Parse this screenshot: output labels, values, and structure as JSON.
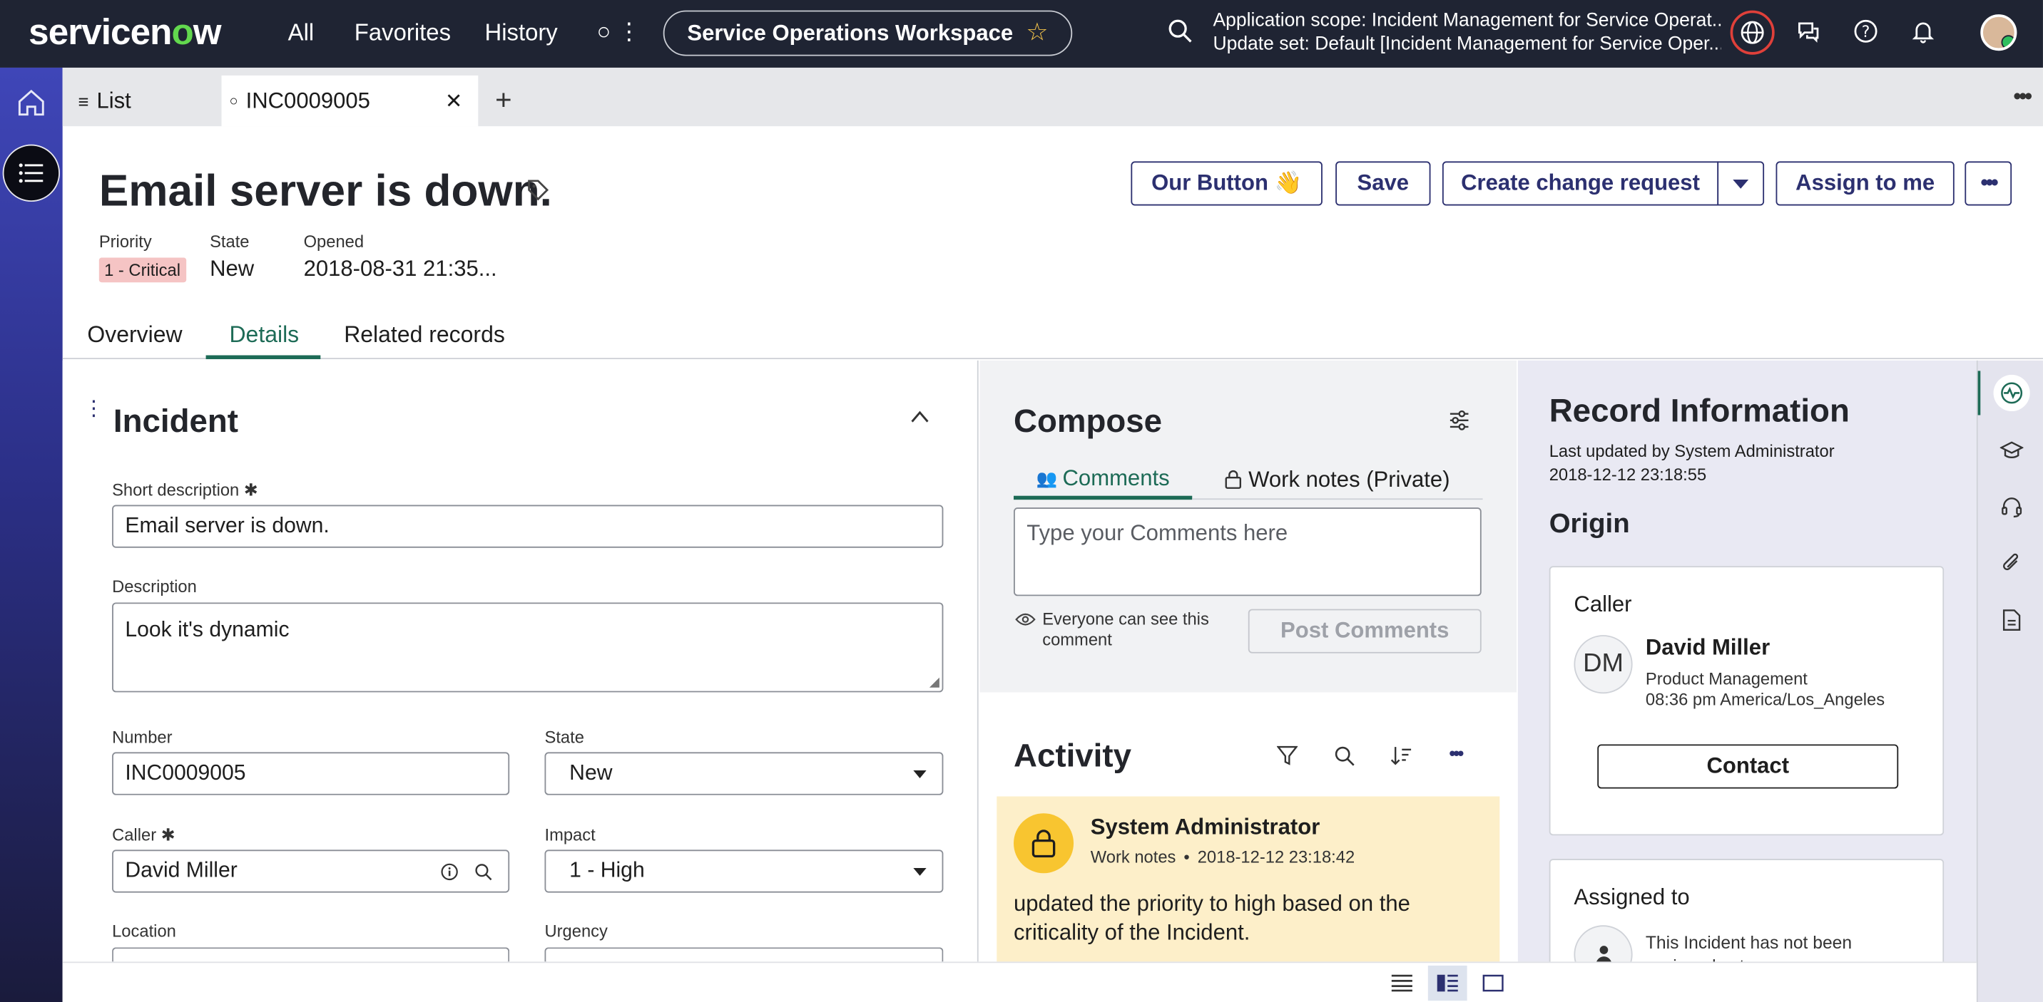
{
  "topnav": {
    "logo_pre": "servicen",
    "logo_o": "o",
    "logo_post": "w",
    "links": [
      "All",
      "Favorites",
      "History"
    ],
    "more_label": "○ ⋮",
    "workspace": "Service Operations Workspace",
    "scope_line1": "Application scope: Incident Management for Service Operat...",
    "scope_line2": "Update set: Default [Incident Management for Service Oper..."
  },
  "tabs": {
    "list_label": "List",
    "record_label": "INC0009005"
  },
  "header": {
    "title": "Email server is down.",
    "priority_label": "Priority",
    "priority_value": "1 - Critical",
    "state_label": "State",
    "state_value": "New",
    "opened_label": "Opened",
    "opened_value": "2018-08-31 21:35...",
    "buttons": {
      "our_button": "Our Button 👋",
      "save": "Save",
      "create_change": "Create change request",
      "assign": "Assign to me"
    }
  },
  "section_tabs": [
    "Overview",
    "Details",
    "Related records"
  ],
  "form": {
    "section_title": "Incident",
    "short_description_label": "Short description ✱",
    "short_description_value": "Email server is down.",
    "description_label": "Description",
    "description_value": "Look it's dynamic",
    "number_label": "Number",
    "number_value": "INC0009005",
    "state_label": "State",
    "state_value": "New",
    "caller_label": "Caller ✱",
    "caller_value": "David Miller",
    "impact_label": "Impact",
    "impact_value": "1 - High",
    "location_label": "Location",
    "urgency_label": "Urgency"
  },
  "compose": {
    "title": "Compose",
    "tab_comments": "Comments",
    "tab_worknotes": "Work notes (Private)",
    "placeholder": "Type your Comments here",
    "visibility_note_1": "Everyone can see this",
    "visibility_note_2": "comment",
    "post_button": "Post Comments"
  },
  "activity": {
    "title": "Activity",
    "entry_author": "System Administrator",
    "entry_type": "Work notes",
    "entry_time": "2018-12-12 23:18:42",
    "entry_text_1": "updated the priority to high based on the",
    "entry_text_2": "criticality of the Incident."
  },
  "record_info": {
    "title": "Record Information",
    "updated_by": "Last updated by System Administrator",
    "updated_at": "2018-12-12 23:18:55",
    "origin_title": "Origin",
    "caller_heading": "Caller",
    "caller_initials": "DM",
    "caller_name": "David Miller",
    "caller_dept": "Product Management",
    "caller_time": "08:36 pm America/Los_Angeles",
    "contact_button": "Contact",
    "assigned_heading": "Assigned to",
    "assigned_text_1": "This Incident has not been",
    "assigned_text_2": "assigned yet"
  },
  "colors": {
    "nav_bg": "#1f2433",
    "accent_green": "#1d6b56",
    "button_navy": "#2c3070",
    "critical_bg": "#f5c4c4",
    "worknote_bg": "#fdefc9",
    "record_bg": "#e9e9f3"
  }
}
